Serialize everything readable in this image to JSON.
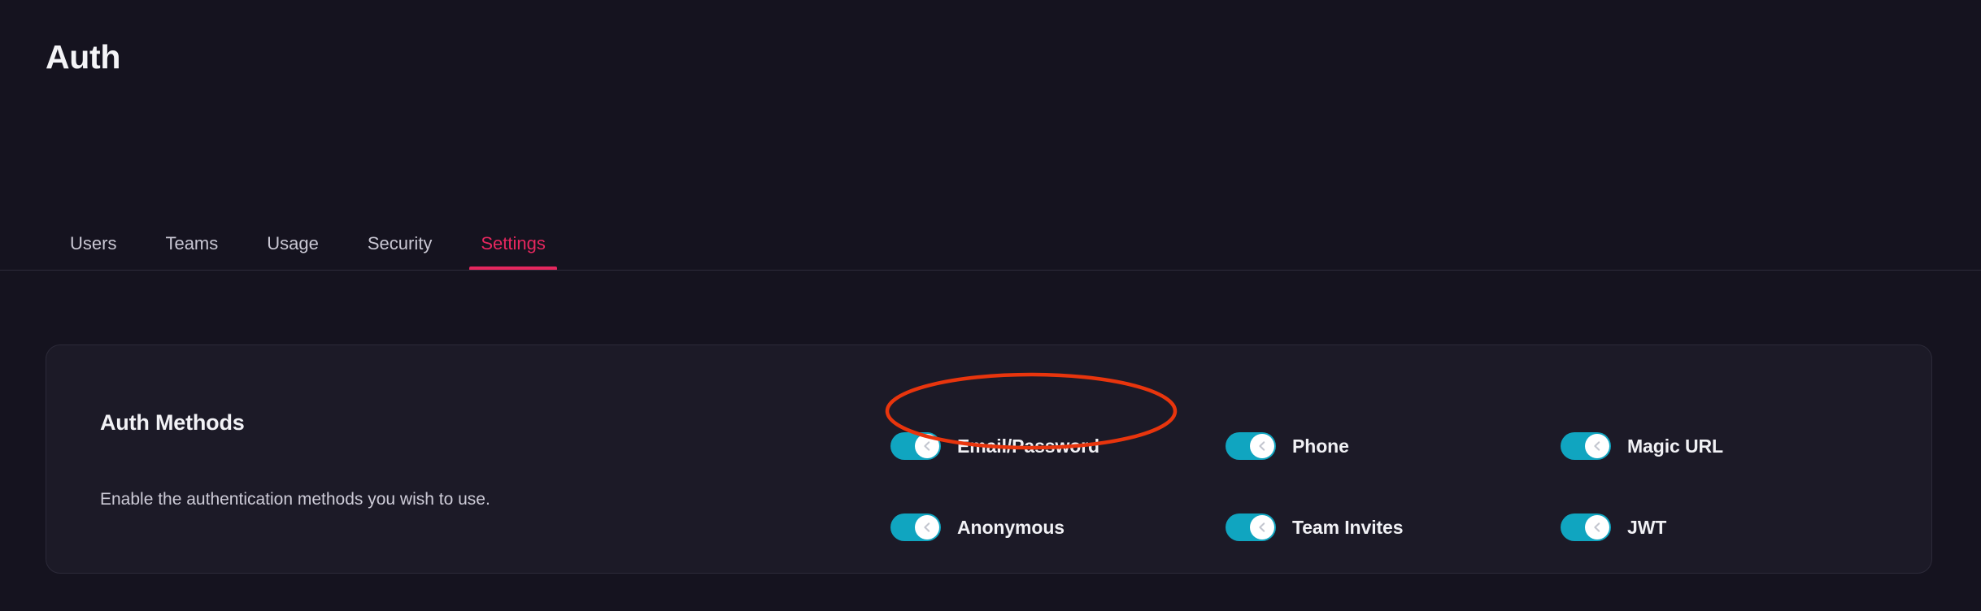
{
  "header": {
    "title": "Auth"
  },
  "tabs": [
    {
      "label": "Users",
      "active": false
    },
    {
      "label": "Teams",
      "active": false
    },
    {
      "label": "Usage",
      "active": false
    },
    {
      "label": "Security",
      "active": false
    },
    {
      "label": "Settings",
      "active": true
    }
  ],
  "card": {
    "heading": "Auth Methods",
    "description": "Enable the authentication methods you wish to use.",
    "methods": [
      {
        "label": "Email/Password",
        "enabled": true,
        "knob_icon": "chevron-left-icon"
      },
      {
        "label": "Phone",
        "enabled": true,
        "knob_icon": "chevron-left-icon"
      },
      {
        "label": "Magic URL",
        "enabled": true,
        "knob_icon": "chevron-left-icon"
      },
      {
        "label": "Anonymous",
        "enabled": true,
        "knob_icon": "chevron-left-icon"
      },
      {
        "label": "Team Invites",
        "enabled": true,
        "knob_icon": "chevron-left-icon"
      },
      {
        "label": "JWT",
        "enabled": true,
        "knob_icon": "chevron-left-icon"
      }
    ]
  },
  "annotation": {
    "target_label": "Email/Password",
    "shape": "ellipse",
    "color": "#e8350d"
  },
  "colors": {
    "page_background": "#15131f",
    "card_background": "#1c1a27",
    "card_border": "#2c2a39",
    "accent_pink": "#e5275e",
    "toggle_on": "#10a5c0",
    "text_primary": "#f2f2f6",
    "text_secondary": "#cdcbd7",
    "annotation": "#e8350d"
  }
}
